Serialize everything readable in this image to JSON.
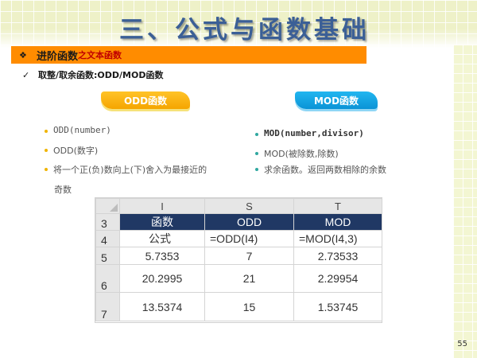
{
  "slide": {
    "title": "三、公式与函数基础",
    "page_number": "55"
  },
  "section": {
    "bullet_icon": "diamond-bullet-icon",
    "main": "进阶函数",
    "sub": "之文本函数"
  },
  "subheading": {
    "icon": "check-icon",
    "text": "取整/取余函数:ODD/MOD函数"
  },
  "pills": {
    "odd": "ODD函数",
    "mod": "MOD函数"
  },
  "odd_bullets": {
    "line1": "ODD(number)",
    "line2": "ODD(数字)",
    "line3a": "将一个正(负)数向上(下)舍入为最接近的",
    "line3b": "奇数"
  },
  "mod_bullets": {
    "line1": "MOD(number,divisor)",
    "line2": "MOD(被除数,除数)",
    "line3": "求余函数。返回两数相除的余数"
  },
  "spreadsheet": {
    "columns": [
      "I",
      "S",
      "T"
    ],
    "rows": [
      {
        "num": "3",
        "cells": [
          "函数",
          "ODD",
          "MOD"
        ]
      },
      {
        "num": "4",
        "cells": [
          "公式",
          "=ODD(I4)",
          "=MOD(I4,3)"
        ]
      },
      {
        "num": "5",
        "cells": [
          "5.7353",
          "7",
          "2.73533"
        ]
      },
      {
        "num": "6",
        "cells": [
          "20.2995",
          "21",
          "2.29954"
        ]
      },
      {
        "num": "7",
        "cells": [
          "13.5374",
          "15",
          "1.53745"
        ]
      }
    ]
  },
  "colors": {
    "title": "#3b5f96",
    "section_bar": "#ff8c00",
    "section_sub": "#c00000",
    "odd_pill": "#f5a500",
    "mod_pill": "#0a93d6",
    "table_header": "#203864"
  }
}
